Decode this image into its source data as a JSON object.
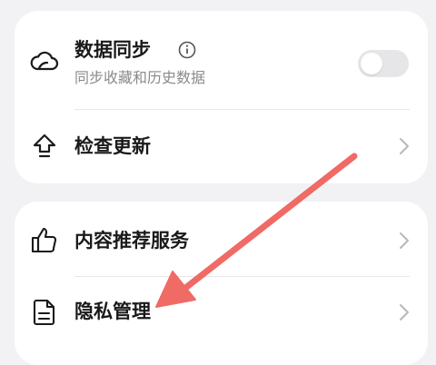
{
  "cards": [
    {
      "rows": [
        {
          "icon": "cloud-icon",
          "title": "数据同步",
          "subtitle": "同步收藏和历史数据",
          "info_icon": "info-icon",
          "toggle_on": false
        },
        {
          "icon": "upload-icon",
          "title": "检查更新",
          "chevron": "chevron-right-icon"
        }
      ]
    },
    {
      "rows": [
        {
          "icon": "thumbs-up-icon",
          "title": "内容推荐服务",
          "chevron": "chevron-right-icon"
        },
        {
          "icon": "document-icon",
          "title": "隐私管理",
          "chevron": "chevron-right-icon"
        }
      ]
    }
  ],
  "annotation": {
    "icon": "red-arrow-icon",
    "color": "#f06a66"
  },
  "colors": {
    "background": "#f2f2f4",
    "card": "#ffffff",
    "title": "#1a1a1a",
    "subtitle": "#8a8a8a",
    "chevron": "#b7b7bc"
  }
}
